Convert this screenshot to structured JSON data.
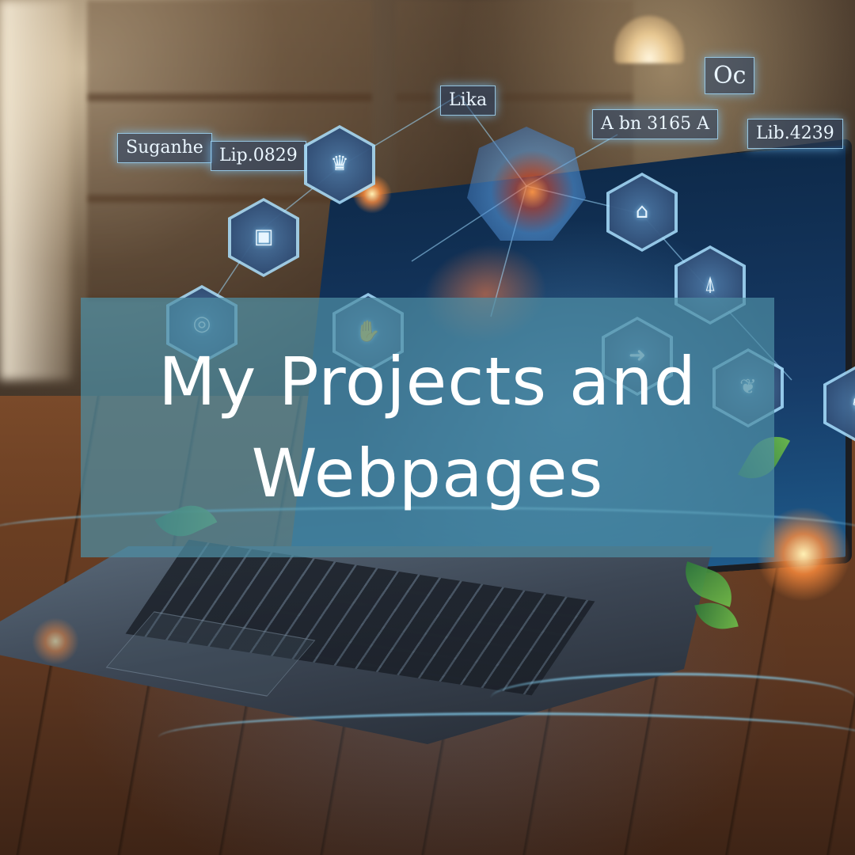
{
  "title": {
    "line1": "My Projects and",
    "line2": "Webpages"
  },
  "holograms": {
    "labels": [
      "Suganhe",
      "Lip.0829",
      "Lika",
      "A bn 3165 A",
      "Oc",
      "Lib.4239"
    ],
    "hex_icons": [
      "crown-icon",
      "camera-icon",
      "map-icon",
      "monument-icon",
      "globe-icon",
      "hand-icon",
      "arrow-icon",
      "chess-icon",
      "plant-icon"
    ]
  },
  "colors": {
    "banner": "#4E8EA4",
    "title_text": "#FFFFFF",
    "hologram_glow": "#8CD2FF"
  }
}
